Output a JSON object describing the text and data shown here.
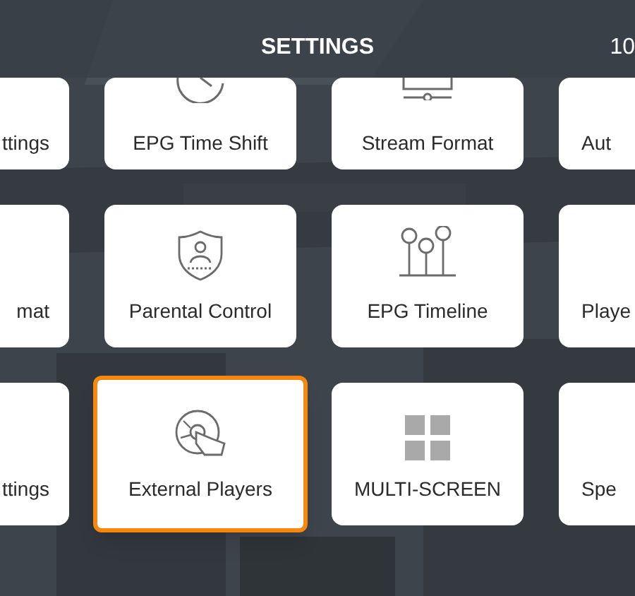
{
  "header": {
    "title": "SETTINGS",
    "time": "10"
  },
  "rows": [
    [
      {
        "label": "ttings",
        "selected": false
      },
      {
        "label": "EPG Time Shift",
        "selected": false
      },
      {
        "label": "Stream Format",
        "selected": false
      },
      {
        "label": "Aut",
        "selected": false
      }
    ],
    [
      {
        "label": "mat",
        "selected": false
      },
      {
        "label": "Parental Control",
        "selected": false
      },
      {
        "label": "EPG Timeline",
        "selected": false
      },
      {
        "label": "Playe",
        "selected": false
      }
    ],
    [
      {
        "label": "ttings",
        "selected": false
      },
      {
        "label": "External Players",
        "selected": true
      },
      {
        "label": "MULTI-SCREEN",
        "selected": false
      },
      {
        "label": "Spe",
        "selected": false
      }
    ]
  ]
}
